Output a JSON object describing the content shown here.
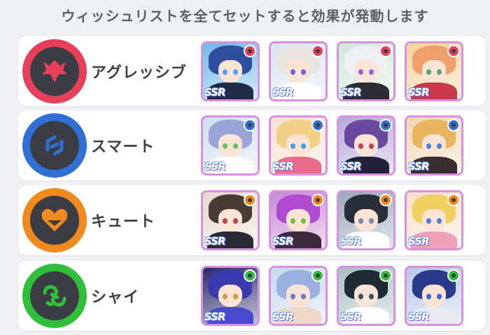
{
  "header": {
    "title": "ウィッシュリストを全てセットすると効果が発動します"
  },
  "rows": [
    {
      "label": "アグレッシブ",
      "icon": "aggressive-icon",
      "color": "#e83f5b",
      "cards": [
        {
          "rarity": "SSR",
          "hair": "#2f4f9e",
          "eye": "#4da3ff",
          "body": "#1f2a44",
          "bg": "#6fb8e8"
        },
        {
          "rarity": "SSR",
          "hair": "#e9e6e2",
          "eye": "#7b5bd6",
          "body": "#ffffff",
          "bg": "#d8e4f0"
        },
        {
          "rarity": "SSR",
          "hair": "#eef0f4",
          "eye": "#8a6bd8",
          "body": "#2d2c34",
          "bg": "#cfe8d8"
        },
        {
          "rarity": "SSR",
          "hair": "#f0a06a",
          "eye": "#58a86a",
          "body": "#c83a4a",
          "bg": "#f6d29a"
        }
      ]
    },
    {
      "label": "スマート",
      "icon": "smart-icon",
      "color": "#2f6fd6",
      "cards": [
        {
          "rarity": "SSR",
          "hair": "#9aa6d8",
          "eye": "#6abf6a",
          "body": "#ffffff",
          "bg": "#cfe0f0"
        },
        {
          "rarity": "SSR",
          "hair": "#f2cf86",
          "eye": "#4aa0e0",
          "body": "#ec6a8a",
          "bg": "#f8e0d0"
        },
        {
          "rarity": "SSR",
          "hair": "#6a4a9e",
          "eye": "#c0405a",
          "body": "#22223a",
          "bg": "#b6a8d8"
        },
        {
          "rarity": "SSR",
          "hair": "#e8b460",
          "eye": "#4f7fd8",
          "body": "#3a2e2e",
          "bg": "#f0d8b0"
        }
      ]
    },
    {
      "label": "キュート",
      "icon": "cute-icon",
      "color": "#f08a1e",
      "cards": [
        {
          "rarity": "SSR",
          "hair": "#4a3a34",
          "eye": "#c04050",
          "body": "#2a2a34",
          "bg": "#e8d8d0"
        },
        {
          "rarity": "SSR",
          "hair": "#b04ad0",
          "eye": "#70c040",
          "body": "#3a2a3a",
          "bg": "#c88ad8"
        },
        {
          "rarity": "SSR",
          "hair": "#2a2e3a",
          "eye": "#7a8ab0",
          "body": "#ffffff",
          "bg": "#9aa8b8"
        },
        {
          "rarity": "SSR",
          "hair": "#f2d060",
          "eye": "#4a80d0",
          "body": "#f0a0b8",
          "bg": "#f8e0c8"
        }
      ]
    },
    {
      "label": "シャイ",
      "icon": "shy-icon",
      "color": "#2fbf3a",
      "cards": [
        {
          "rarity": "SSR",
          "hair": "#3a3ab0",
          "eye": "#d0a040",
          "body": "#4a4ad0",
          "bg": "#2a2a6a"
        },
        {
          "rarity": "SSR",
          "hair": "#9ab0e0",
          "eye": "#6080c0",
          "body": "#f0d8c8",
          "bg": "#c8d8f0"
        },
        {
          "rarity": "SSR",
          "hair": "#1e2a34",
          "eye": "#3a5060",
          "body": "#ffffff",
          "bg": "#a8c0c0"
        },
        {
          "rarity": "SSR",
          "hair": "#2a3a8a",
          "eye": "#3a6ad0",
          "body": "#eaeaf2",
          "bg": "#b8c8e8"
        }
      ]
    }
  ]
}
